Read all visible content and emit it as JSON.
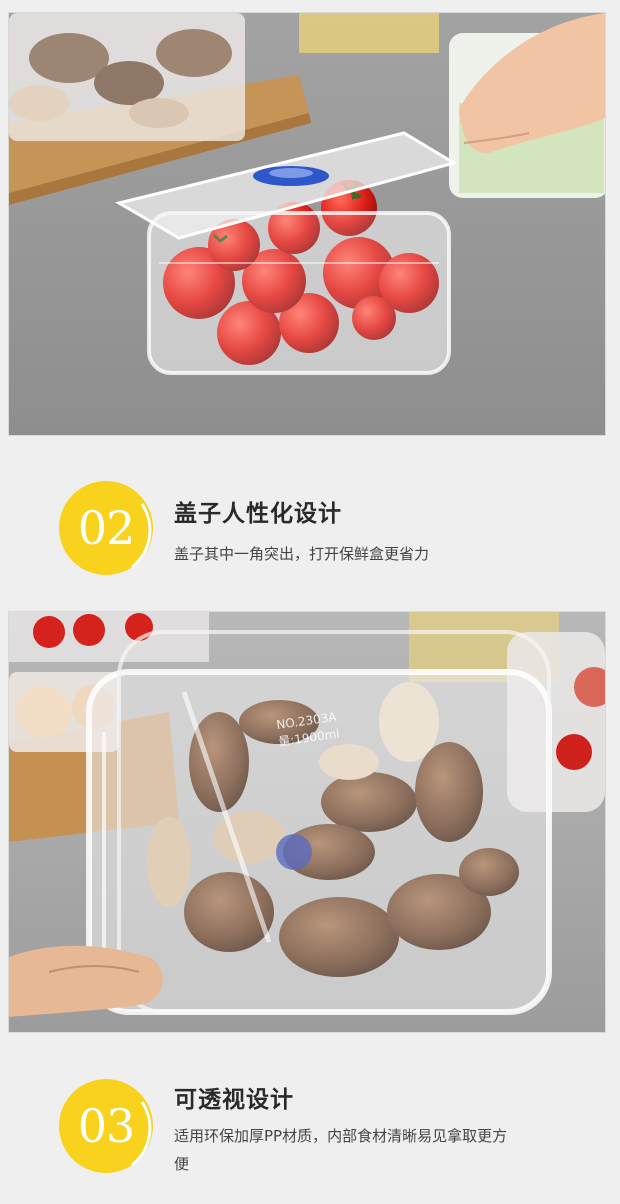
{
  "features": [
    {
      "number": "02",
      "title": "盖子人性化设计",
      "description": "盖子其中一角突出，打开保鲜盒更省力"
    },
    {
      "number": "03",
      "title": "可透视设计",
      "description": "适用环保加厚PP材质，内部食材清晰易见拿取更方便"
    }
  ],
  "photo_2": {
    "container_marking_model": "NO.2303A",
    "container_marking_capacity": "量:1900ml"
  },
  "colors": {
    "badge": "#f8d21c",
    "background": "#efefef",
    "photo_surface": "#9a9a9a"
  }
}
